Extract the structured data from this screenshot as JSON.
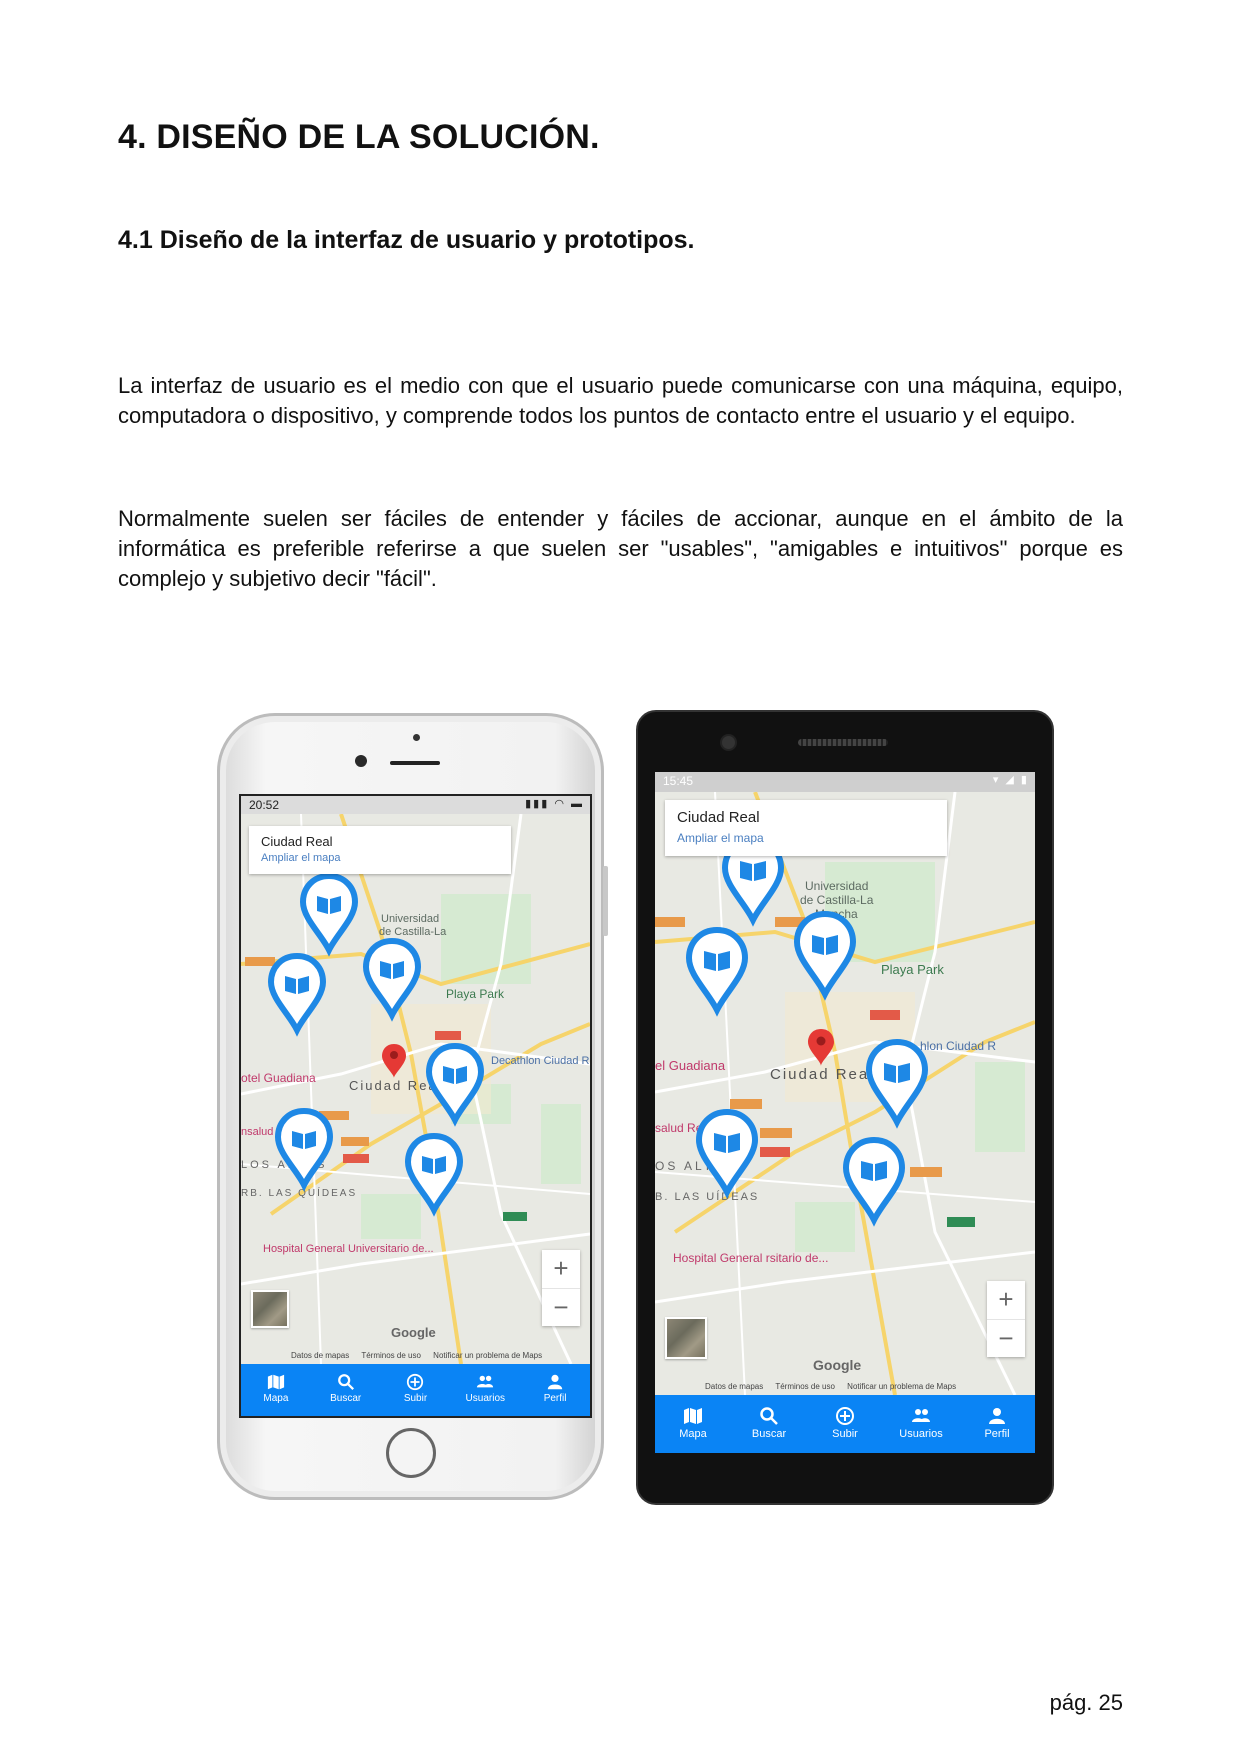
{
  "heading": "4. DISEÑO DE LA SOLUCIÓN.",
  "subheading": "4.1 Diseño de la interfaz de usuario y prototipos.",
  "paragraphs": [
    "La interfaz de usuario es el medio con que el usuario puede comunicarse con una máquina, equipo, computadora o dispositivo, y comprende todos los puntos de contacto entre el usuario y el equipo.",
    "Normalmente suelen ser fáciles de entender y fáciles de accionar, aunque en el ámbito de la informática es preferible referirse a que suelen ser \"usables\", \"amigables e intuitivos\" porque es complejo y subjetivo decir \"fácil\"."
  ],
  "page_number": "pág. 25",
  "ios_prototype": {
    "status_time": "20:52",
    "map_card": {
      "title": "Ciudad Real",
      "link": "Ampliar el mapa"
    },
    "map_labels": {
      "city": "Ciudad Real",
      "university": "Universidad de Castilla-La Mancha",
      "park": "Playa Park",
      "hotel": "otel Guadiana",
      "decathlon": "Decathlon Ciudad Re",
      "hospital": "Hospital General Universitario de...",
      "district_1": "LOS ALTOS",
      "district_2": "RB. LAS QUÍDEAS",
      "health": "nsalud d Real"
    },
    "zoom_in": "+",
    "zoom_out": "−",
    "google": "Google",
    "footer": [
      "Datos de mapas",
      "Términos de uso",
      "Notificar un problema de Maps"
    ],
    "nav": [
      "Mapa",
      "Buscar",
      "Subir",
      "Usuarios",
      "Perfil"
    ]
  },
  "android_prototype": {
    "status_time": "15:45",
    "map_card": {
      "title": "Ciudad Real",
      "link": "Ampliar el mapa"
    },
    "map_labels": {
      "city": "Ciudad Real",
      "university": "Universidad de Castilla-La Mancha",
      "park": "Playa Park",
      "hotel": "el Guadiana",
      "decathlon": "hlon Ciudad R",
      "hospital": "Hospital General rsitario de...",
      "district_1": "OS ALTOS",
      "district_2": "B. LAS UÍDEAS",
      "health": "salud Real"
    },
    "zoom_in": "+",
    "zoom_out": "−",
    "google": "Google",
    "footer": [
      "Datos de mapas",
      "Términos de uso",
      "Notificar un problema de Maps"
    ],
    "nav": [
      "Mapa",
      "Buscar",
      "Subir",
      "Usuarios",
      "Perfil"
    ]
  },
  "colors": {
    "nav_bar": "#0a84f5",
    "book_marker": "#1e88e5",
    "location_pin": "#e53935"
  },
  "icons": {
    "nav": [
      "map-icon",
      "search-icon",
      "add-circle-icon",
      "users-icon",
      "person-icon"
    ],
    "marker": "book-marker-icon",
    "pin": "location-pin-icon"
  }
}
